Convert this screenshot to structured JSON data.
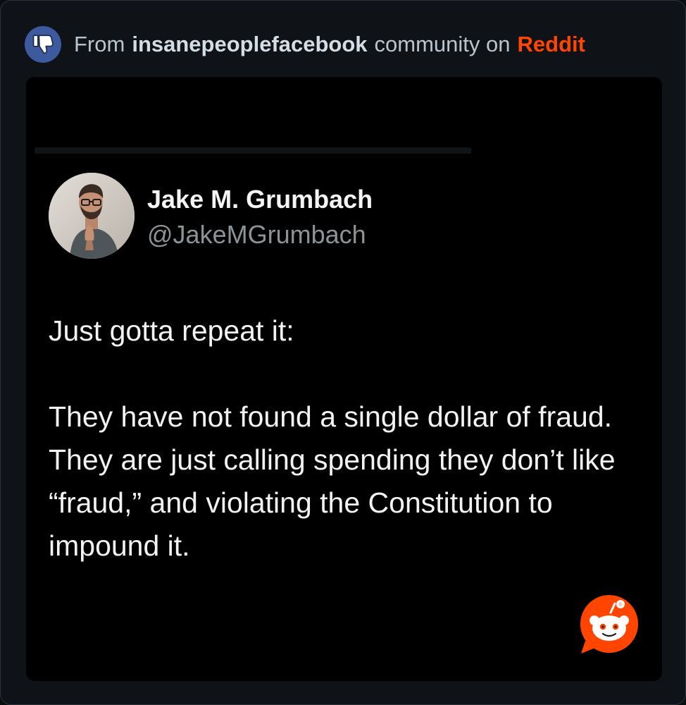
{
  "header": {
    "prefix": "From",
    "community": "insanepeoplefacebook",
    "middle": "community on",
    "brand": "Reddit",
    "subreddit_icon": "thumbs-down-icon"
  },
  "post": {
    "author_name": "Jake M. Grumbach",
    "author_handle": "@JakeMGrumbach",
    "paragraph_1": "Just gotta repeat it:",
    "paragraph_2": "They have not found a single dollar of fraud. They are just calling spending they don’t like “fraud,” and violating the Constitution to impound it.",
    "badge_icon": "reddit-snoo-icon"
  },
  "colors": {
    "brand": "#ff4500",
    "background": "#0f1317",
    "post_background": "#000000",
    "subreddit_icon_bg": "#3d5a9f"
  }
}
